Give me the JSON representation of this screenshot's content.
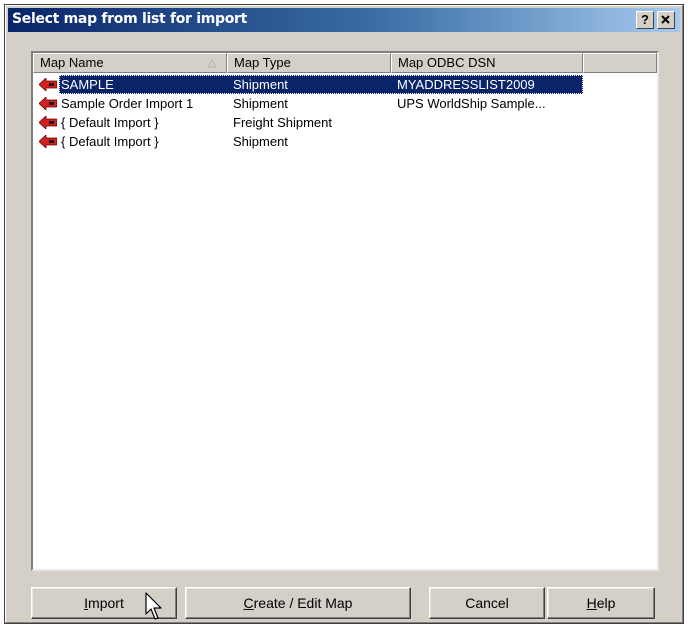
{
  "window": {
    "title": "Select map from list for import",
    "help_label": "?",
    "close_label": "✕"
  },
  "list": {
    "columns": [
      {
        "label": "Map Name",
        "sort": "ascending"
      },
      {
        "label": "Map Type"
      },
      {
        "label": "Map ODBC DSN"
      },
      {
        "label": ""
      }
    ],
    "rows": [
      {
        "name": "SAMPLE",
        "type": "Shipment",
        "dsn": "MYADDRESSLIST2009",
        "selected": true,
        "icon": "import-map-arrow-icon"
      },
      {
        "name": "Sample Order Import 1",
        "type": "Shipment",
        "dsn": "UPS WorldShip Sample...",
        "selected": false,
        "icon": "import-map-arrow-icon"
      },
      {
        "name": "{ Default Import }",
        "type": "Freight Shipment",
        "dsn": "",
        "selected": false,
        "icon": "import-map-arrow-icon"
      },
      {
        "name": "{ Default Import }",
        "type": "Shipment",
        "dsn": "",
        "selected": false,
        "icon": "import-map-arrow-icon"
      }
    ]
  },
  "buttons": {
    "import": {
      "pre": "",
      "key": "I",
      "post": "mport"
    },
    "create_edit": {
      "pre": "",
      "key": "C",
      "post": "reate / Edit Map"
    },
    "cancel": {
      "label": "Cancel"
    },
    "help": {
      "pre": "",
      "key": "H",
      "post": "elp"
    }
  },
  "colors": {
    "title_gradient_start": "#0a246a",
    "selection": "#0a246a",
    "icon_red": "#d42020",
    "dialog_face": "#d4d0c8"
  }
}
